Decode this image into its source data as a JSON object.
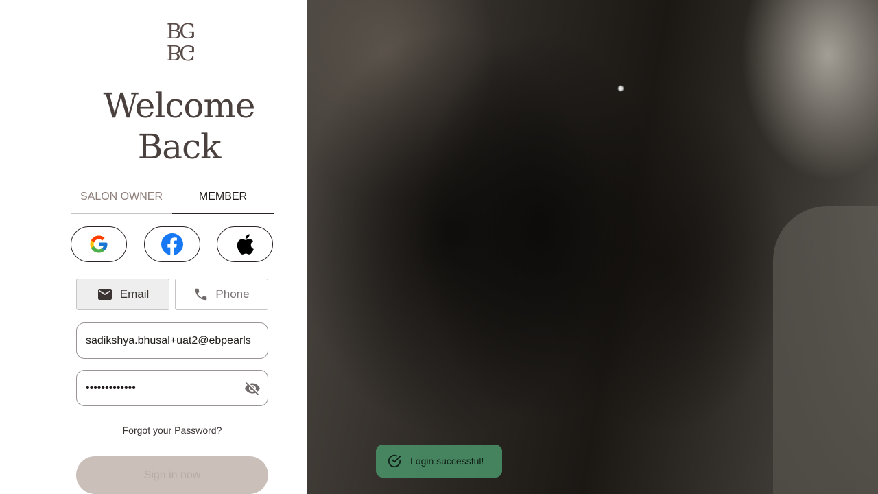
{
  "brand": {
    "logo_top": "BG",
    "logo_bottom": "BG"
  },
  "heading": {
    "line1": "Welcome",
    "line2": "Back"
  },
  "tabs": [
    {
      "label": "SALON OWNER",
      "active": false
    },
    {
      "label": "MEMBER",
      "active": true
    }
  ],
  "social": [
    {
      "name": "google",
      "icon": "google-icon"
    },
    {
      "name": "facebook",
      "icon": "facebook-icon"
    },
    {
      "name": "apple",
      "icon": "apple-icon"
    }
  ],
  "login_method": {
    "email_label": "Email",
    "phone_label": "Phone",
    "selected": "Email"
  },
  "form": {
    "email_value": "sadikshya.bhusal+uat2@ebpearls",
    "password_masked": "•••••••••••••",
    "password_visibility_icon": "eye-off-icon",
    "forgot_label": "Forgot your Password?",
    "submit_label": "Sign in now"
  },
  "toast": {
    "message": "Login successful!",
    "icon": "check-circle-icon"
  },
  "colors": {
    "text_dark": "#4a403e",
    "submit_bg": "#cbbfba",
    "toast_bg": "#4a9168"
  }
}
